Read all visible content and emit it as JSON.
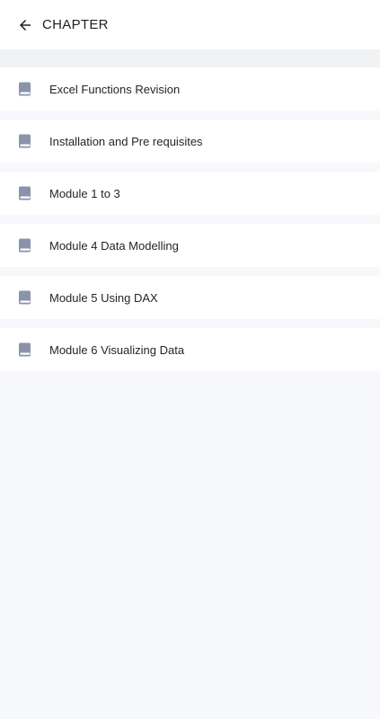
{
  "header": {
    "title": "CHAPTER",
    "back_icon": "arrow-left-icon"
  },
  "chapters": [
    {
      "label": "Excel Functions Revision",
      "icon": "book-icon"
    },
    {
      "label": "Installation and Pre requisites",
      "icon": "book-icon"
    },
    {
      "label": "Module 1 to 3",
      "icon": "book-icon"
    },
    {
      "label": "Module 4 Data Modelling",
      "icon": "book-icon"
    },
    {
      "label": "Module 5 Using DAX",
      "icon": "book-icon"
    },
    {
      "label": "Module 6 Visualizing Data",
      "icon": "book-icon"
    }
  ],
  "colors": {
    "background": "#f7f8fb",
    "card": "#ffffff",
    "icon": "#8a93a8",
    "text": "#1f2328"
  }
}
